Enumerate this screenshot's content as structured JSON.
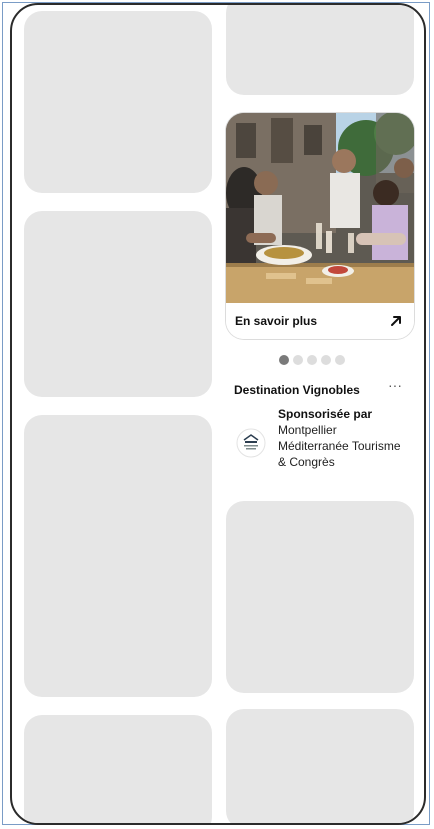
{
  "promoted_pin": {
    "cta_label": "En savoir plus",
    "cta_icon": "arrow-up-right-icon",
    "carousel": {
      "total": 5,
      "active_index": 0
    },
    "title": "Destination Vignobles",
    "more_label": "···",
    "sponsor_label": "Sponsorisée par",
    "sponsor_name": "Montpellier Méditerranée Tourisme & Congrès",
    "photo_icon": "outdoor-dining-photo"
  },
  "colors": {
    "placeholder": "#e6e6e6",
    "frame": "#2b2b2b",
    "dot_active": "#7a7a7a",
    "dot_inactive": "#dddddd"
  }
}
